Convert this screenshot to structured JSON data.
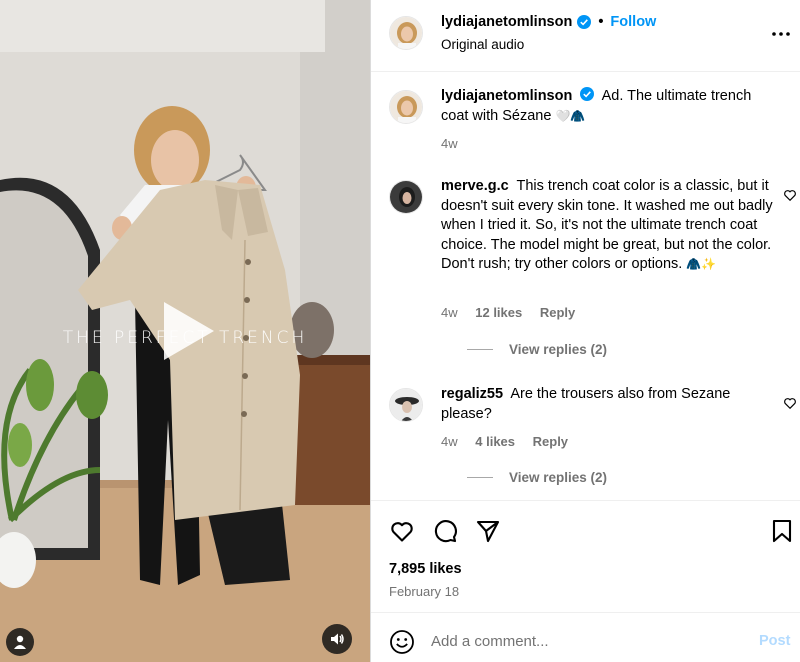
{
  "media": {
    "overlay_text": "THE PERFECT TRENCH",
    "icons": {
      "play": "play-icon",
      "user_tag": "user-icon",
      "sound": "speaker-icon"
    }
  },
  "header": {
    "username": "lydiajanetomlinson",
    "verified": true,
    "separator": "•",
    "follow_label": "Follow",
    "audio_label": "Original audio",
    "more_icon": "more-options-icon"
  },
  "caption": {
    "username": "lydiajanetomlinson",
    "text": "Ad. The ultimate trench coat with Sézane",
    "emoji": "🤍🧥",
    "age": "4w"
  },
  "comments": [
    {
      "username": "merve.g.c",
      "text": "This trench coat color is a classic, but it doesn't suit every skin tone. It washed me out badly when I tried it. So, it's not the ultimate trench coat choice. The model might be great, but not the color. Don't rush; try other colors or options.",
      "emoji": "🧥✨",
      "age": "4w",
      "likes": "12 likes",
      "reply_label": "Reply",
      "view_replies": "View replies (2)"
    },
    {
      "username": "regaliz55",
      "text": "Are the trousers also from Sezane please?",
      "emoji": "",
      "age": "4w",
      "likes": "4 likes",
      "reply_label": "Reply",
      "view_replies": "View replies (2)"
    }
  ],
  "actions": {
    "icons": [
      "heart-icon",
      "comment-icon",
      "share-icon",
      "bookmark-icon"
    ],
    "likes_count": "7,895 likes",
    "date": "February 18"
  },
  "add_comment": {
    "placeholder": "Add a comment...",
    "post_label": "Post",
    "emoji_icon": "emoji-icon"
  },
  "colors": {
    "link_blue": "#0095f6",
    "post_disabled": "#b3dbff",
    "secondary_text": "#737373",
    "divider": "#efefef"
  }
}
